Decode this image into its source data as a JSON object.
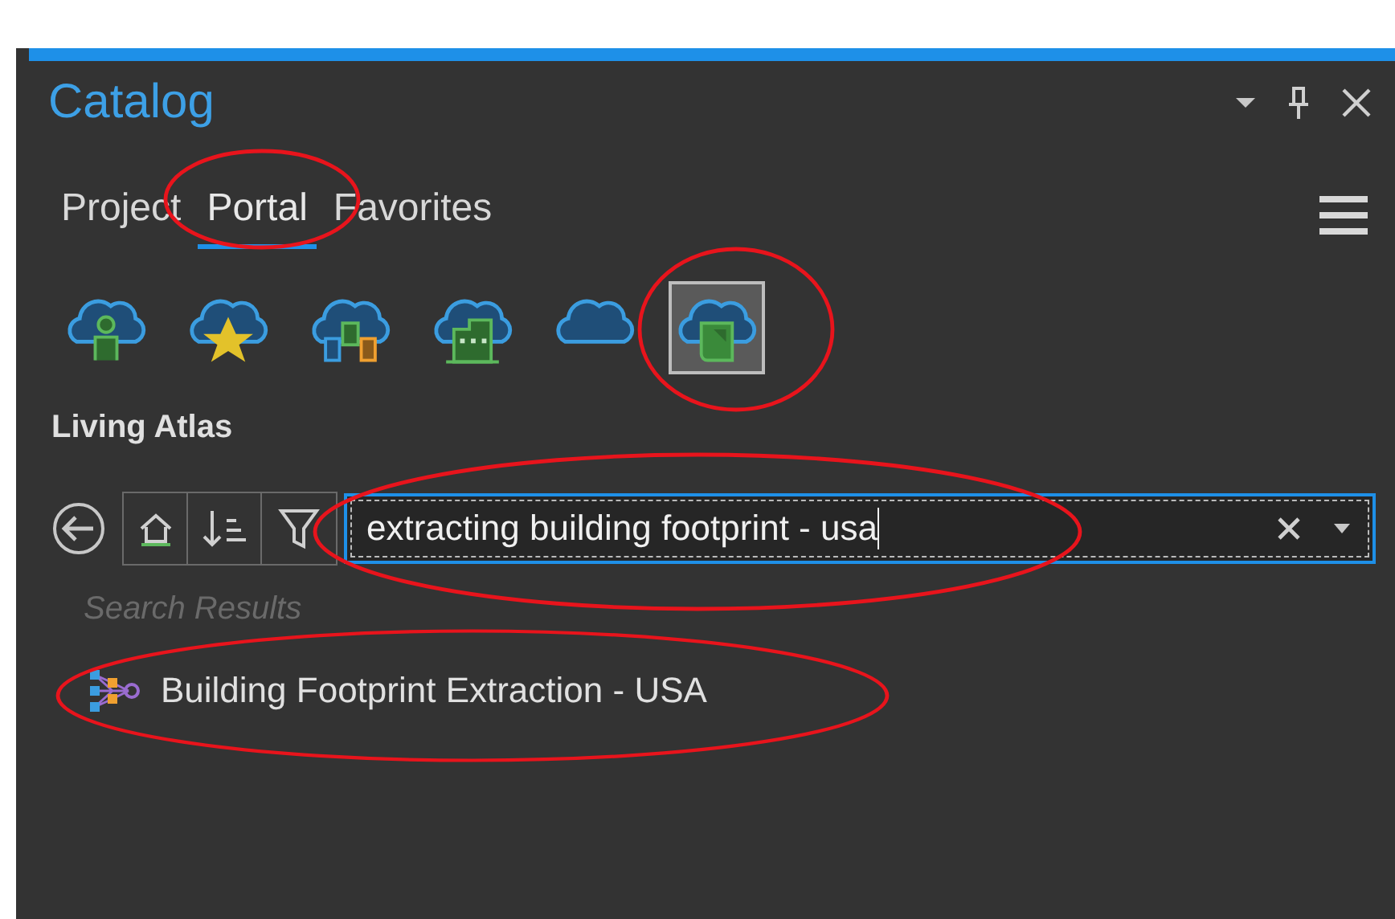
{
  "pane": {
    "title": "Catalog"
  },
  "tabs": [
    {
      "label": "Project",
      "selected": false,
      "circled": false
    },
    {
      "label": "Portal",
      "selected": true,
      "circled": true
    },
    {
      "label": "Favorites",
      "selected": false,
      "circled": false
    }
  ],
  "sources": [
    {
      "kind": "my-content",
      "selected": false,
      "circled": false
    },
    {
      "kind": "favorites",
      "selected": false,
      "circled": false
    },
    {
      "kind": "groups",
      "selected": false,
      "circled": false
    },
    {
      "kind": "organization",
      "selected": false,
      "circled": false
    },
    {
      "kind": "arcgis-online",
      "selected": false,
      "circled": false
    },
    {
      "kind": "living-atlas",
      "selected": true,
      "circled": true
    }
  ],
  "section_title": "Living Atlas",
  "search": {
    "value": "extracting building footprint - usa",
    "circled": true
  },
  "results_heading": "Search Results",
  "results": [
    {
      "label": "Building Footprint Extraction - USA",
      "circled": true
    }
  ]
}
